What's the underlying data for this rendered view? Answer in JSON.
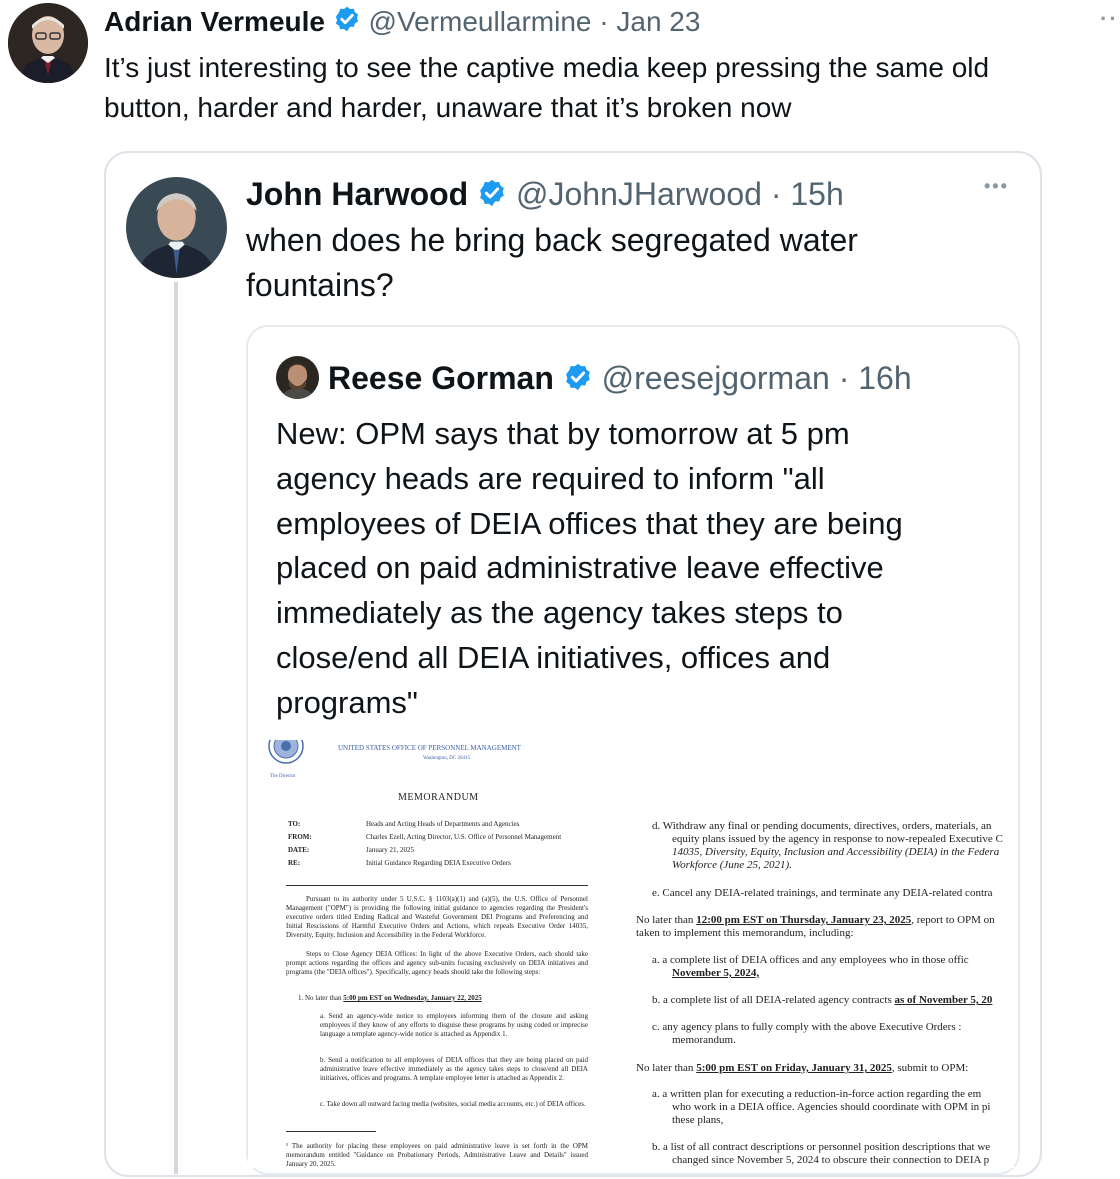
{
  "main_tweet": {
    "author_name": "Adrian Vermeule",
    "handle": "@Vermeullarmine",
    "time": "· Jan 23",
    "text_line1": "It’s just interesting to see the captive media keep pressing the same old",
    "text_line2": "button, harder and harder, unaware that it’s broken now",
    "more": "··"
  },
  "quoted_tweet": {
    "author_name": "John Harwood",
    "handle": "@JohnJHarwood",
    "time": "· 15h",
    "text_line1": "when does he bring back segregated water",
    "text_line2": "fountains?",
    "more": "•••"
  },
  "nested_tweet": {
    "author_name": "Reese Gorman",
    "handle": "@reesejgorman",
    "time": "· 16h",
    "lines": [
      "New: OPM says that by tomorrow at 5 pm",
      "agency heads are required to inform \"all",
      "employees of DEIA offices that they are being",
      "placed on paid administrative leave effective",
      "immediately as the agency takes steps to",
      "close/end all DEIA initiatives, offices and",
      "programs\""
    ]
  },
  "memo": {
    "agency": "UNITED STATES OFFICE OF PERSONNEL MANAGEMENT",
    "city": "Washington, DC 20415",
    "director": "The Director",
    "title": "MEMORANDUM",
    "to_label": "TO:",
    "to": "Heads and Acting Heads of Departments and Agencies",
    "from_label": "FROM:",
    "from": "Charles Ezell, Acting Director, U.S. Office of Personnel Management",
    "date_label": "DATE:",
    "date": "January 21, 2025",
    "re_label": "RE:",
    "re": "Initial Guidance Regarding DEIA Executive Orders",
    "left_p1": "Pursuant to its authority under 5 U.S.C. § 1103(a)(1) and (a)(5), the U.S. Office of Personnel Management (\"OPM\") is providing the following initial guidance to agencies regarding the President's executive orders titled Ending Radical and Wasteful Government DEI Programs and Preferencing and Initial Rescissions of Harmful Executive Orders and Actions, which repeals Executive Order 14035, Diversity, Equity, Inclusion and Accessibility in the Federal Workforce.",
    "left_p2": "Steps to Close Agency DEIA Offices: In light of the above Executive Orders, each should take prompt actions regarding the offices and agency sub-units focusing exclusively on DEIA initiatives and programs (the \"DEIA offices\"). Specifically, agency heads should take the following steps:",
    "left_item1_prefix": "1.   No later than",
    "left_item1_deadline": "5:00 pm EST on Wednesday, January 22, 2025",
    "left_item_a": "a.   Send an agency-wide notice to employees informing them of the closure and asking employees if they know of any efforts to disguise these programs by using coded or imprecise language a template agency-wide notice is attached as Appendix 1.",
    "left_item_b": "b.   Send a notification to all employees of DEIA offices that they are being placed on paid administrative leave effective immediately as the agency takes steps to close/end all DEIA initiatives, offices and programs. A template employee letter is attached as Appendix 2.",
    "left_item_c": "c.   Take down all outward facing media (websites, social media accounts, etc.) of DEIA offices.",
    "left_footnote": "¹ The authority for placing these employees on paid administrative leave is set forth in the OPM memorandum entitled \"Guidance on Probationary Periods, Administrative Leave and Details\" issued January 20, 2025.",
    "right_d1": "d.   Withdraw any final or pending documents, directives, orders, materials, an",
    "right_d2": "equity plans issued by the agency in response to now-repealed Executive C",
    "right_d3": "14035, Diversity, Equity, Inclusion and Accessibility (DEIA) in the Federa",
    "right_d4": "Workforce (June 25, 2021).",
    "right_e": "e.   Cancel any DEIA-related trainings, and terminate any DEIA-related contra",
    "right_nlt1_prefix": "No later than",
    "right_nlt1_deadline": "12:00 pm EST on Thursday, January 23, 2025",
    "right_nlt1_suffix": ", report to OPM on",
    "right_nlt1_line2": "taken to implement this memorandum, including:",
    "right_a1": "a.   a complete list of DEIA offices and any employees who in those offic",
    "right_a1_line2": "November 5, 2024,",
    "right_b1": "b.   a complete list of all DEIA-related agency contracts",
    "right_b1_u": "as of November 5, 20",
    "right_c1": "c.   any agency plans to fully comply with the above Executive Orders :",
    "right_c1_line2": "memorandum.",
    "right_nlt2_prefix": "No later than",
    "right_nlt2_deadline": "5:00 pm EST on Friday, January 31, 2025",
    "right_nlt2_suffix": ", submit to OPM:",
    "right_a2": "a.   a written plan for executing a reduction-in-force action regarding the em",
    "right_a2_line2": "who work in a DEIA office. Agencies should coordinate with OPM in pi",
    "right_a2_line3": "these plans,",
    "right_b2": "b.   a list of all contract descriptions or personnel position descriptions that we",
    "right_b2_line2": "changed since November 5, 2024 to obscure their connection to DEIA p"
  },
  "colors": {
    "verified": "#1d9bf0",
    "secondary_text": "#536471",
    "border": "#dde3e8"
  }
}
